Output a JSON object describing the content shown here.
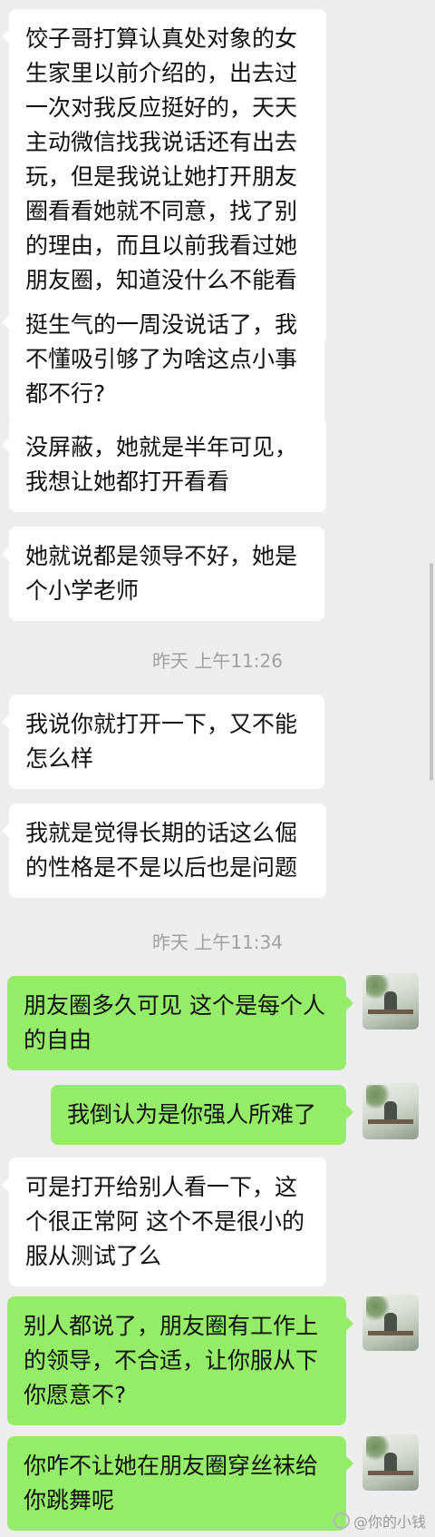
{
  "messages": [
    {
      "side": "in",
      "text": "饺子哥打算认真处对象的女生家里以前介绍的，出去过一次对我反应挺好的，天天主动微信找我说话还有出去玩，但是我说让她打开朋友圈看看她就不同意，找了别的理由，而且以前我看过她朋友圈，知道没什么不能看的。"
    },
    {
      "side": "in",
      "text": "挺生气的一周没说话了，我不懂吸引够了为啥这点小事都不行?"
    },
    {
      "side": "in",
      "text": "没屏蔽，她就是半年可见，我想让她都打开看看"
    },
    {
      "side": "in",
      "text": "她就说都是领导不好，她是个小学老师"
    },
    {
      "side": "in",
      "text": "我说你就打开一下，又不能怎么样"
    },
    {
      "side": "in",
      "text": "我就是觉得长期的话这么倔的性格是不是以后也是问题"
    },
    {
      "side": "out",
      "text": "朋友圈多久可见 这个是每个人的自由"
    },
    {
      "side": "out",
      "text": "我倒认为是你强人所难了"
    },
    {
      "side": "in",
      "text": "可是打开给别人看一下，这个很正常阿 这个不是很小的服从测试了么"
    },
    {
      "side": "out",
      "text": "别人都说了，朋友圈有工作上的领导，不合适，让你服从下你愿意不?"
    },
    {
      "side": "out",
      "text": "你咋不让她在朋友圈穿丝袜给你跳舞呢"
    }
  ],
  "timestamps": [
    "昨天 上午11:26",
    "昨天 上午11:34"
  ],
  "watermark": "@你的小钱",
  "colors": {
    "background": "#ededed",
    "incoming": "#ffffff",
    "outgoing": "#95ec69"
  }
}
